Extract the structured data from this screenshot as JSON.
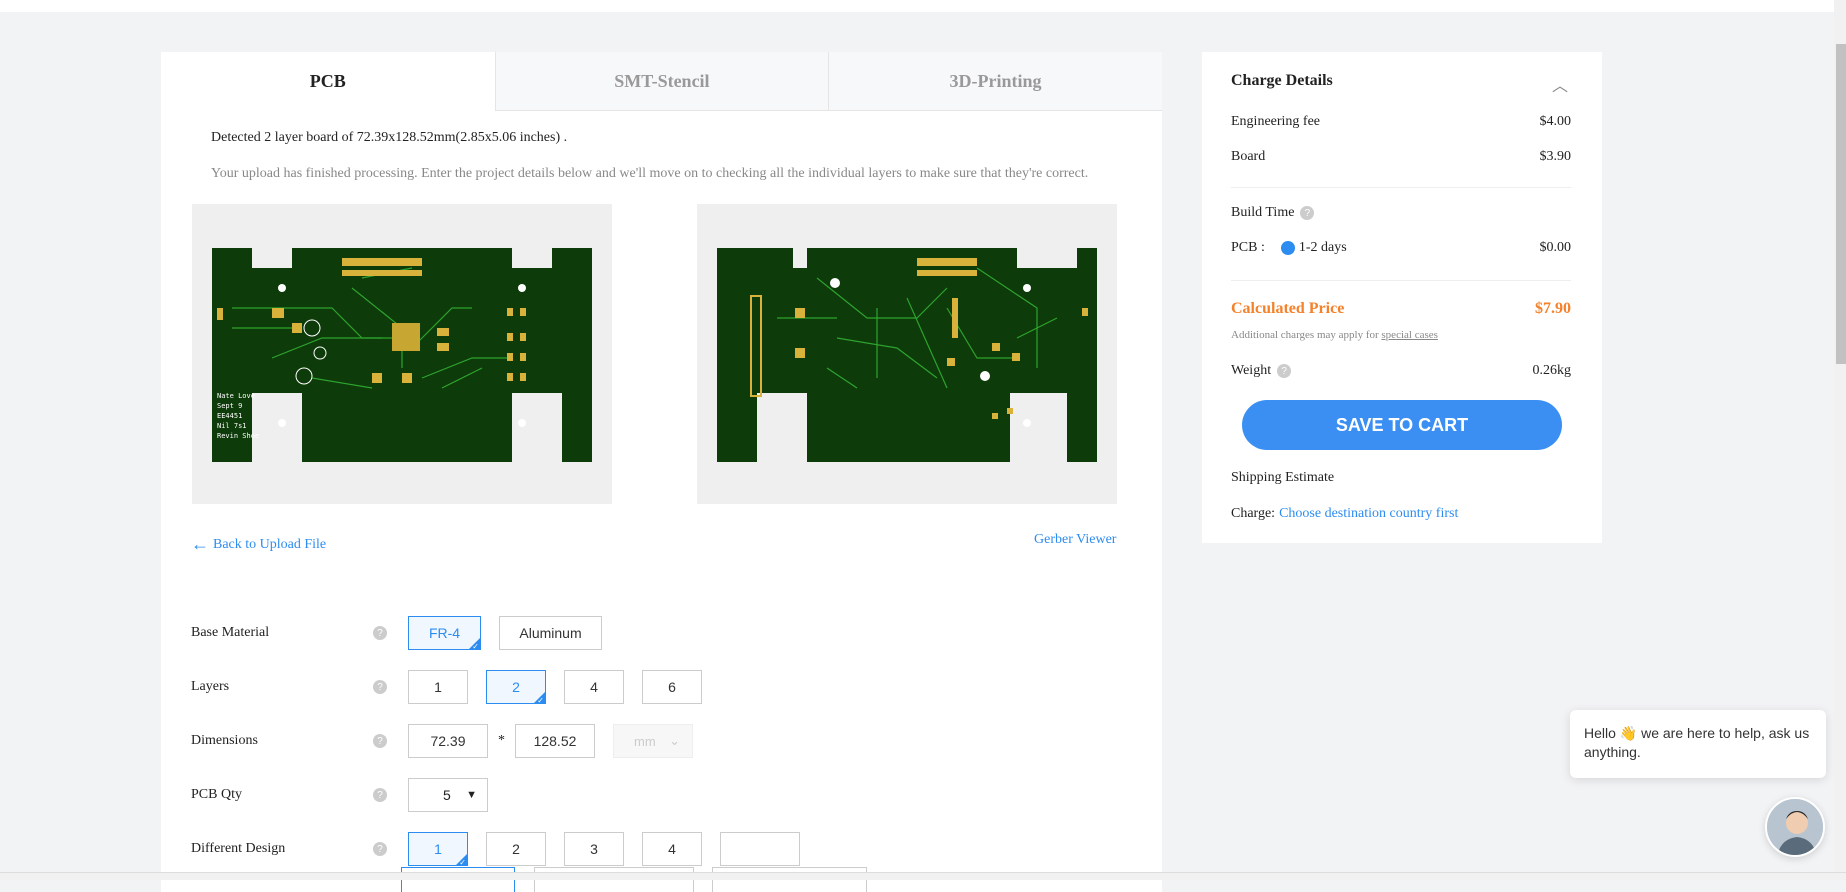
{
  "tabs": [
    {
      "label": "PCB",
      "active": true
    },
    {
      "label": "SMT-Stencil",
      "active": false
    },
    {
      "label": "3D-Printing",
      "active": false
    }
  ],
  "detected_text": "Detected 2 layer board of 72.39x128.52mm(2.85x5.06 inches) .",
  "notice_text": "Your upload has finished processing. Enter the project details below and we'll move on to checking all the individual layers to make sure that they're correct.",
  "back_link": "Back to Upload File",
  "gerber_link": "Gerber Viewer",
  "form": {
    "base_material": {
      "label": "Base Material",
      "options": [
        "FR-4",
        "Aluminum"
      ],
      "selected": "FR-4"
    },
    "layers": {
      "label": "Layers",
      "options": [
        "1",
        "2",
        "4",
        "6"
      ],
      "selected": "2"
    },
    "dimensions": {
      "label": "Dimensions",
      "width": "72.39",
      "separator": "*",
      "height": "128.52",
      "unit": "mm"
    },
    "pcb_qty": {
      "label": "PCB Qty",
      "value": "5"
    },
    "different_design": {
      "label": "Different Design",
      "options": [
        "1",
        "2",
        "3",
        "4"
      ],
      "selected": "1",
      "custom": ""
    }
  },
  "charge": {
    "title": "Charge Details",
    "engineering_fee": {
      "label": "Engineering fee",
      "value": "$4.00"
    },
    "board": {
      "label": "Board",
      "value": "$3.90"
    },
    "build_time": {
      "label": "Build Time"
    },
    "pcb_build": {
      "label": "PCB :",
      "option": "1-2 days",
      "value": "$0.00"
    },
    "calculated": {
      "label": "Calculated Price",
      "value": "$7.90"
    },
    "note_prefix": "Additional charges may apply for ",
    "note_link": "special cases",
    "weight": {
      "label": "Weight",
      "value": "0.26kg"
    },
    "save_button": "SAVE TO CART",
    "shipping_label": "Shipping Estimate",
    "charge_label": "Charge:",
    "charge_link": "Choose destination country first"
  },
  "chat": {
    "message": "Hello 👋 we are here to help, ask us anything."
  },
  "colors": {
    "accent": "#2d8cf0",
    "price": "#f5822b",
    "button": "#3b8ff3",
    "pcb": "#0d3b0a"
  }
}
